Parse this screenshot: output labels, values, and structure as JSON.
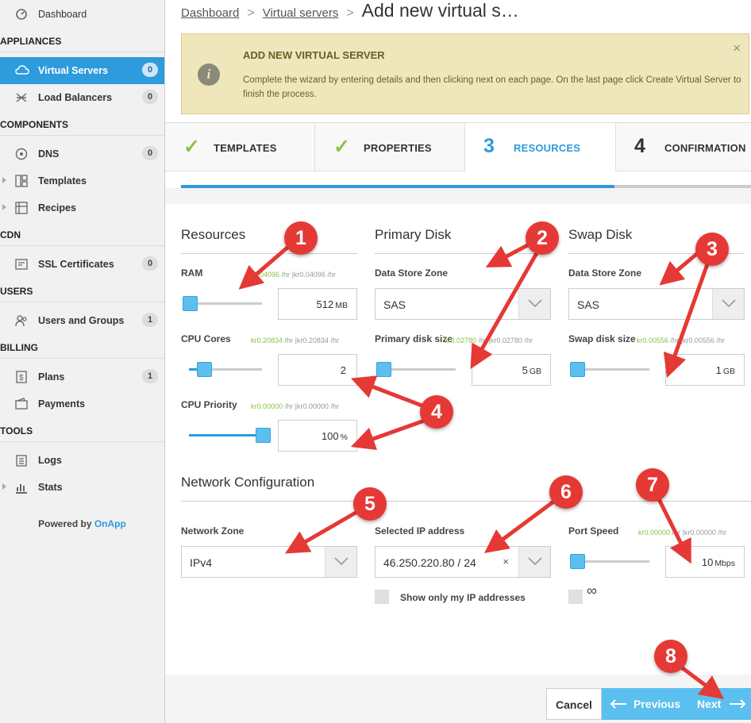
{
  "sidebar": {
    "dashboard": "Dashboard",
    "sections": {
      "appliances": "APPLIANCES",
      "components": "COMPONENTS",
      "cdn": "CDN",
      "users": "USERS",
      "billing": "BILLING",
      "tools": "TOOLS"
    },
    "items": {
      "virtual_servers": {
        "label": "Virtual Servers",
        "count": "0"
      },
      "load_balancers": {
        "label": "Load Balancers",
        "count": "0"
      },
      "dns": {
        "label": "DNS",
        "count": "0"
      },
      "templates": {
        "label": "Templates"
      },
      "recipes": {
        "label": "Recipes"
      },
      "ssl": {
        "label": "SSL Certificates",
        "count": "0"
      },
      "users_groups": {
        "label": "Users and Groups",
        "count": "1"
      },
      "plans": {
        "label": "Plans",
        "count": "1"
      },
      "payments": {
        "label": "Payments"
      },
      "logs": {
        "label": "Logs"
      },
      "stats": {
        "label": "Stats"
      }
    },
    "powered_by": "Powered by",
    "powered_brand": "OnApp"
  },
  "breadcrumb": {
    "dashboard": "Dashboard",
    "virtual_servers": "Virtual servers",
    "current": "Add new virtual s…"
  },
  "notice": {
    "title": "ADD NEW VIRTUAL SERVER",
    "body": "Complete the wizard by entering details and then clicking next on each page. On the last page click Create Virtual Server to finish the process.",
    "close": "×"
  },
  "steps": [
    {
      "number": "✓",
      "label": "TEMPLATES",
      "state": "done"
    },
    {
      "number": "✓",
      "label": "PROPERTIES",
      "state": "done"
    },
    {
      "number": "3",
      "label": "RESOURCES",
      "state": "current"
    },
    {
      "number": "4",
      "label": "CONFIRMATION",
      "state": "pending"
    }
  ],
  "progress": 0.76,
  "resources": {
    "title": "Resources",
    "ram": {
      "label": "RAM",
      "price_a": "kr0.04096",
      "price_b": "kr0.04096",
      "per_hr": "/hr",
      "value": "512",
      "unit": "MB"
    },
    "cpu_cores": {
      "label": "CPU Cores",
      "price_a": "kr0.20834",
      "price_b": "kr0.20834",
      "per_hr": "/hr",
      "value": "2",
      "unit": ""
    },
    "cpu_priority": {
      "label": "CPU Priority",
      "price_a": "kr0.00000",
      "price_b": "kr0.00000",
      "per_hr": "/hr",
      "value": "100",
      "unit": "%"
    }
  },
  "primary_disk": {
    "title": "Primary Disk",
    "zone_label": "Data Store Zone",
    "zone_value": "SAS",
    "size_label": "Primary disk size",
    "price_a": "kr0.02780",
    "price_b": "kr0.02780",
    "per_hr": "/hr",
    "value": "5",
    "unit": "GB"
  },
  "swap_disk": {
    "title": "Swap Disk",
    "zone_label": "Data Store Zone",
    "zone_value": "SAS",
    "size_label": "Swap disk size",
    "price_a": "kr0.00556",
    "price_b": "kr0.00556",
    "per_hr": "/hr",
    "value": "1",
    "unit": "GB"
  },
  "network": {
    "title": "Network Configuration",
    "zone_label": "Network Zone",
    "zone_value": "IPv4",
    "ip_label": "Selected IP address",
    "ip_value": "46.250.220.80 / 24",
    "ip_clear": "×",
    "show_only_mine": "Show only my IP addresses",
    "port_label": "Port Speed",
    "port_price_a": "kr0.00000",
    "port_price_b": "kr0.00000",
    "per_hr": "/hr",
    "port_value": "10",
    "port_unit": "Mbps",
    "unlimited": "∞"
  },
  "buttons": {
    "cancel": "Cancel",
    "previous": "Previous",
    "next": "Next"
  },
  "annotations": [
    "1",
    "2",
    "3",
    "4",
    "5",
    "6",
    "7",
    "8"
  ],
  "colors": {
    "accent": "#2d9bdc",
    "check": "#8bc34a",
    "annotation": "#e53935",
    "notice_bg": "#efe6bb"
  },
  "slider_levels": {
    "ram": 0.0,
    "cpu_cores": 0.2,
    "cpu_priority": 1.0,
    "primary_disk": 0.0,
    "swap_disk": 0.0,
    "port_speed": 0.0
  }
}
